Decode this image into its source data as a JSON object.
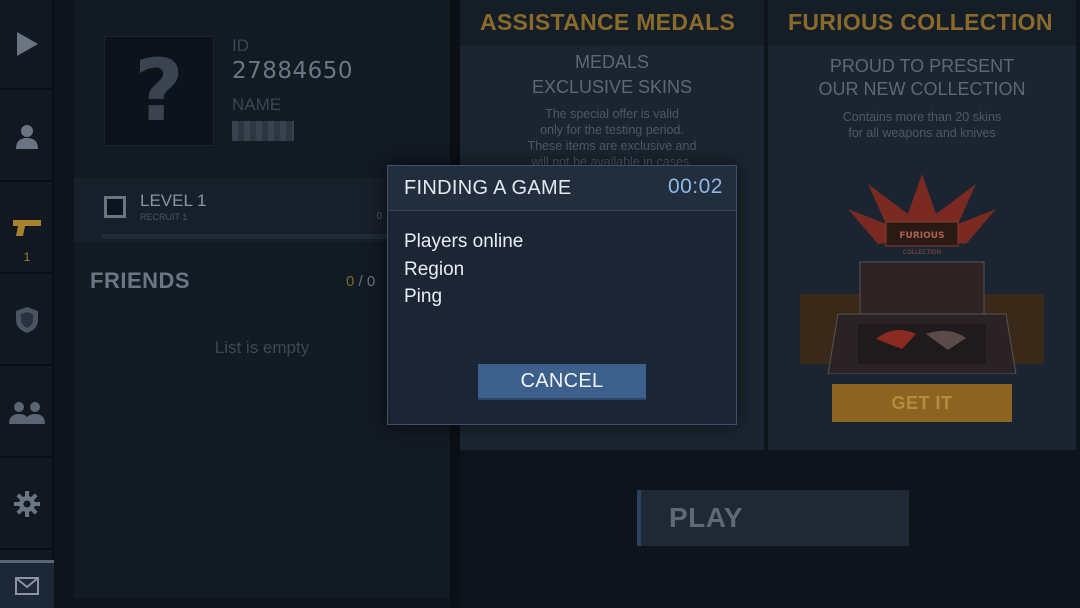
{
  "sidebar": {
    "items": [
      {
        "icon": "play-icon"
      },
      {
        "icon": "profile-icon"
      },
      {
        "icon": "pistol-icon",
        "count": "1"
      },
      {
        "icon": "shield-icon"
      },
      {
        "icon": "friends-icon"
      },
      {
        "icon": "gear-icon"
      }
    ],
    "mail_icon": "mail-icon"
  },
  "profile": {
    "avatar_placeholder": "?",
    "id_label": "ID",
    "id_value": "27884650",
    "name_label": "NAME",
    "level_label": "LEVEL 1",
    "rank_label": "RECRUIT 1",
    "progress_value": "0"
  },
  "friends": {
    "title": "FRIENDS",
    "online": "0",
    "separator": "/",
    "total": "0",
    "empty_text": "List is empty"
  },
  "medals_card": {
    "title": "ASSISTANCE MEDALS",
    "heading_1": "MEDALS",
    "heading_2": "EXCLUSIVE SKINS",
    "desc_1": "The special offer is valid",
    "desc_2": "only for the testing period.",
    "desc_3": "These items are exclusive and",
    "desc_4": "will not be available in cases."
  },
  "furious_card": {
    "title": "FURIOUS COLLECTION",
    "heading_1": "PROUD TO PRESENT",
    "heading_2": "OUR NEW COLLECTION",
    "desc_1": "Contains more than 20 skins",
    "desc_2": "for all weapons and knives",
    "logo_1": "FURIOUS",
    "logo_2": "COLLECTION",
    "button": "GET IT"
  },
  "play_button": "PLAY",
  "modal": {
    "title": "FINDING A GAME",
    "timer": "00:02",
    "lines": [
      "Players online",
      "Region",
      "Ping"
    ],
    "cancel": "CANCEL"
  },
  "colors": {
    "accent_gold": "#8a6a2a",
    "modal_button": "#3c5f8c",
    "timer": "#8fb8e6"
  }
}
